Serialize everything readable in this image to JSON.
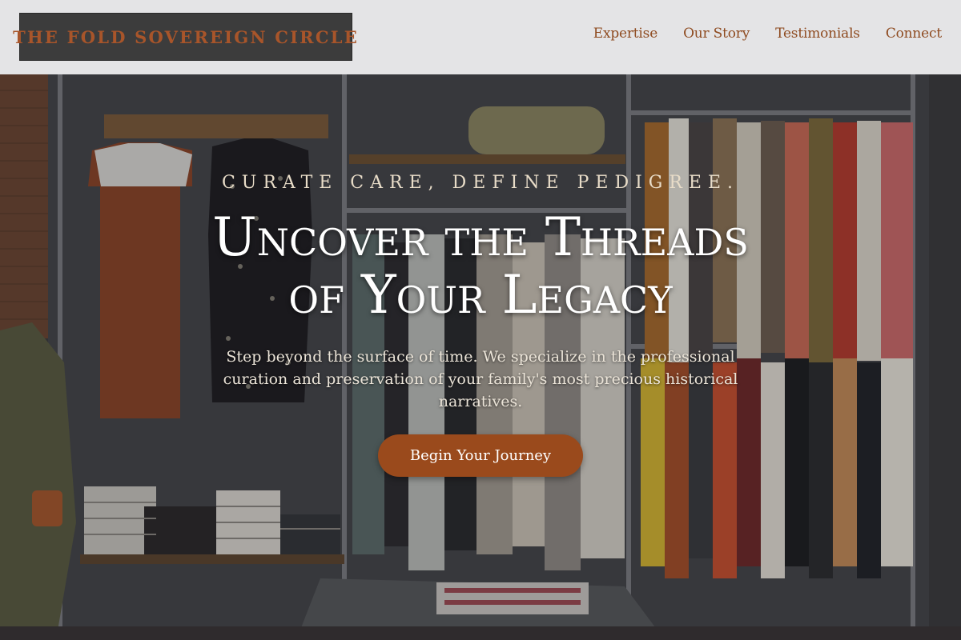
{
  "header": {
    "logo": "THE FOLD SOVEREIGN CIRCLE",
    "nav": [
      "Expertise",
      "Our Story",
      "Testimonials",
      "Connect"
    ]
  },
  "hero": {
    "eyebrow": "Curate Care, Define Pedigree.",
    "headline_line1": "Uncover the Threads",
    "headline_line2": "of Your Legacy",
    "subtext": "Step beyond the surface of time. We specialize in the professional curation and preservation of your family's most precious historical narratives.",
    "cta": "Begin Your Journey",
    "background_image": "boutique-clothing-racks-photo"
  },
  "colors": {
    "accent": "#9a4a1c",
    "logo_bg": "#3c3c3c",
    "logo_text": "#a8552a",
    "nav_text": "#8e4a1f",
    "header_bg": "#ececee"
  }
}
